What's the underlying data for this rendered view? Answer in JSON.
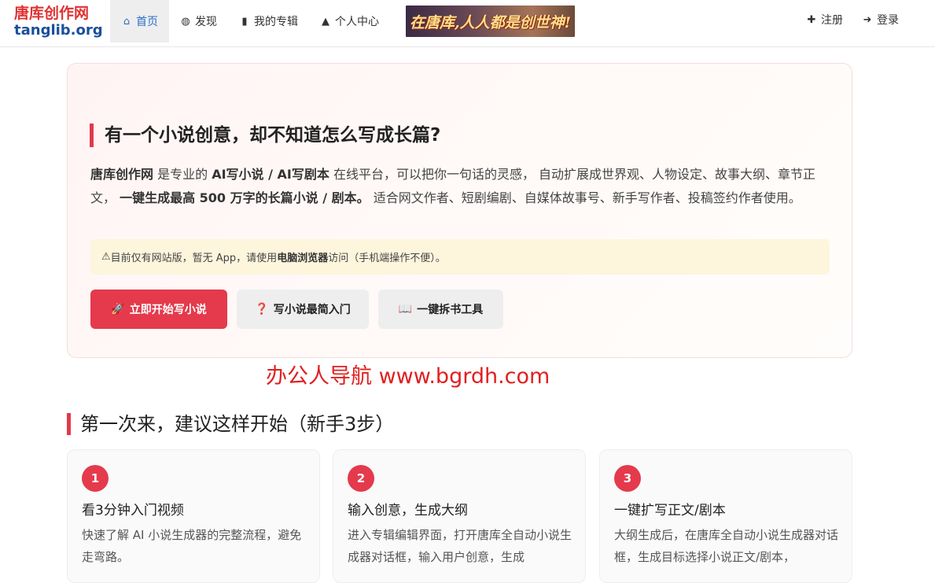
{
  "navbar": {
    "logo_cn": "唐库创作网",
    "logo_en": "tanglib.org",
    "items": [
      {
        "icon": "⌂",
        "label": "首页"
      },
      {
        "icon": "◍",
        "label": "发现"
      },
      {
        "icon": "▮",
        "label": "我的专辑"
      },
      {
        "icon": "▲",
        "label": "个人中心"
      }
    ],
    "banner_text": "在唐库,人人都是创世神!",
    "register_icon": "✚",
    "register_label": "注册",
    "login_icon": "➜",
    "login_label": "登录"
  },
  "hero": {
    "title": "有一个小说创意，却不知道怎么写成长篇?",
    "desc": {
      "brand": "唐库创作网",
      "t1": " 是专业的 ",
      "b1": "AI写小说 / AI写剧本",
      "t2": " 在线平台，可以把你一句话的灵感， 自动扩展成世界观、人物设定、故事大纲、章节正文， ",
      "b2": "一键生成最高 500 万字的长篇小说 / 剧本。",
      "t3": " 适合网文作者、短剧编剧、自媒体故事号、新手写作者、投稿签约作者使用。"
    },
    "notice": {
      "icon": "⚠",
      "t1": " 目前仅有网站版，暂无 App，请使用 ",
      "b1": "电脑浏览器",
      "t2": " 访问（手机端操作不便）。"
    },
    "buttons": [
      {
        "icon": "🚀",
        "label": "立即开始写小说"
      },
      {
        "icon": "❓",
        "label": "写小说最简入门"
      },
      {
        "icon": "📖",
        "label": "一键拆书工具"
      }
    ]
  },
  "watermark": "办公人导航  www.bgrdh.com",
  "steps_section": {
    "title": "第一次来，建议这样开始（新手3步）",
    "steps": [
      {
        "num": "1",
        "title": "看3分钟入门视频",
        "desc": "快速了解 AI 小说生成器的完整流程，避免走弯路。"
      },
      {
        "num": "2",
        "title": "输入创意，生成大纲",
        "desc": "进入专辑编辑界面，打开唐库全自动小说生成器对话框，输入用户创意，生成"
      },
      {
        "num": "3",
        "title": "一键扩写正文/剧本",
        "desc": "大纲生成后，在唐库全自动小说生成器对话框，生成目标选择小说正文/剧本，"
      }
    ]
  },
  "colors": {
    "brand_red": "#e43a4c",
    "logo_blue": "#1a4f9c",
    "nav_active": "#2a6fc9",
    "notice_bg": "#fdf5dc"
  }
}
